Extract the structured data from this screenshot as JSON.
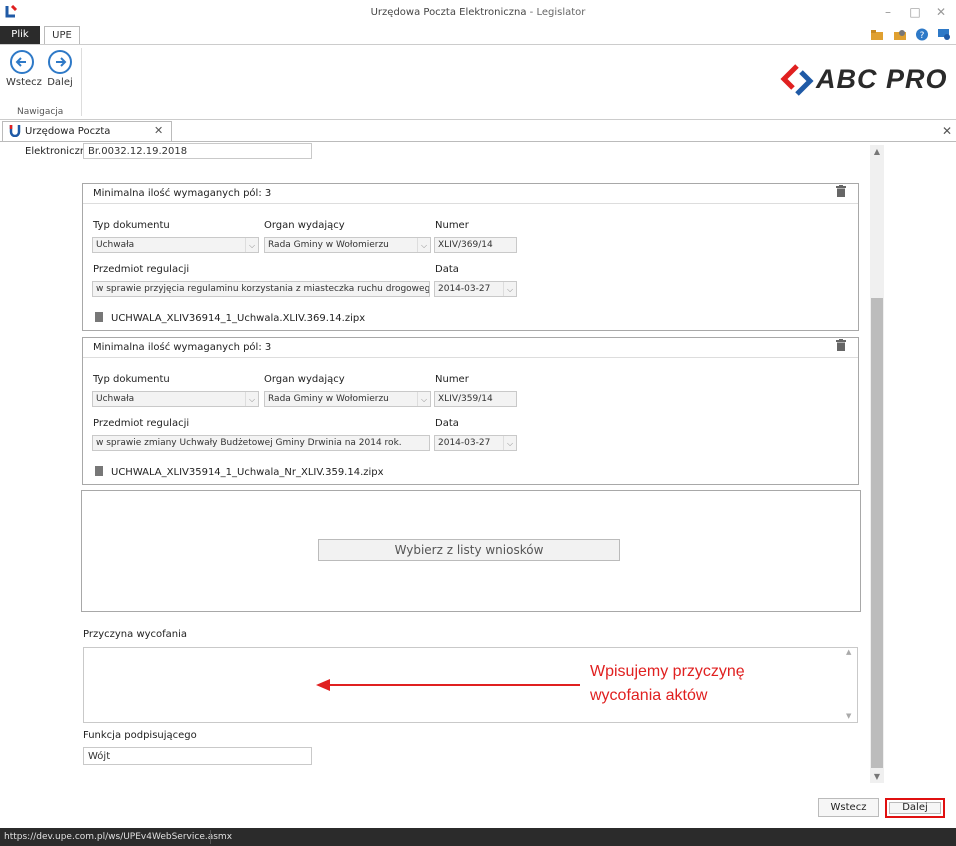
{
  "window": {
    "title": "Urzędowa Poczta Elektroniczna",
    "title_sep": " - ",
    "app_name": "Legislator"
  },
  "ribbon": {
    "tabs": [
      "Plik",
      "UPE"
    ],
    "buttons": [
      {
        "label": "Wstecz",
        "icon": "arrow-left-icon"
      },
      {
        "label": "Dalej",
        "icon": "arrow-right-icon"
      }
    ],
    "group_label": "Nawigacja"
  },
  "brand": {
    "logo_text": "ABC PRO",
    "colors": {
      "red": "#e02020",
      "blue": "#1f5aa6",
      "dark": "#2a2a2a"
    }
  },
  "doc_tab": {
    "label": "Urzędowa Poczta Elektroniczna"
  },
  "form": {
    "top_value": "Br.0032.12.19.2018",
    "acts": [
      {
        "header": "Minimalna ilość wymaganych pól: 3",
        "typ_label": "Typ dokumentu",
        "typ_value": "Uchwała",
        "organ_label": "Organ wydający",
        "organ_value": "Rada Gminy w Wołomierzu",
        "numer_label": "Numer",
        "numer_value": "XLIV/369/14",
        "przedmiot_label": "Przedmiot regulacji",
        "przedmiot_value": "w sprawie przyjęcia regulaminu korzystania z miasteczka ruchu drogowego w miejsco",
        "data_label": "Data",
        "data_value": "2014-03-27",
        "file": "UCHWALA_XLIV36914_1_Uchwala.XLIV.369.14.zipx"
      },
      {
        "header": "Minimalna ilość wymaganych pól: 3",
        "typ_label": "Typ dokumentu",
        "typ_value": "Uchwała",
        "organ_label": "Organ wydający",
        "organ_value": "Rada Gminy w Wołomierzu",
        "numer_label": "Numer",
        "numer_value": "XLIV/359/14",
        "przedmiot_label": "Przedmiot regulacji",
        "przedmiot_value": "w sprawie zmiany Uchwały Budżetowej Gminy Drwinia na 2014 rok.",
        "data_label": "Data",
        "data_value": "2014-03-27",
        "file": "UCHWALA_XLIV35914_1_Uchwala_Nr_XLIV.359.14.zipx"
      }
    ],
    "choose_button": "Wybierz z listy wniosków",
    "reason_label": "Przyczyna wycofania",
    "reason_value": "",
    "signer_label": "Funkcja podpisującego",
    "signer_value": "Wójt"
  },
  "annotation": {
    "line1": "Wpisujemy przyczynę",
    "line2": "wycofania aktów",
    "color": "#e02020"
  },
  "footer": {
    "back": "Wstecz",
    "next": "Dalej"
  },
  "status": {
    "url": "https://dev.upe.com.pl/ws/UPEv4WebService.asmx"
  }
}
